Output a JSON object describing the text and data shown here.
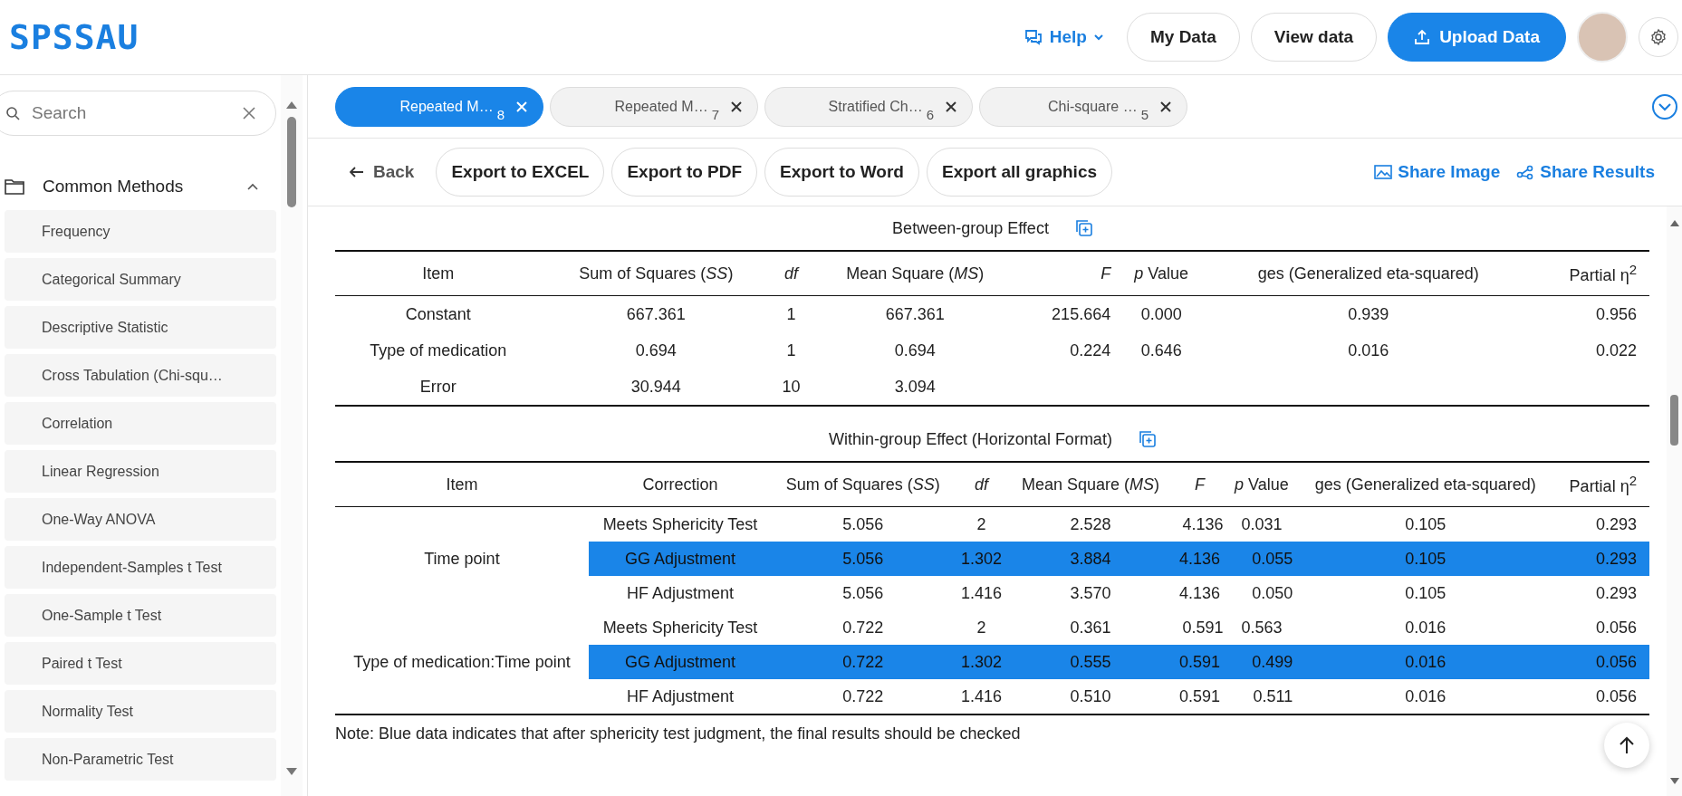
{
  "header": {
    "logo": "SPSSAU",
    "help": "Help",
    "buttons": [
      {
        "label": "My Data",
        "kind": "plain"
      },
      {
        "label": "View data",
        "kind": "plain"
      },
      {
        "label": "Upload Data",
        "kind": "primary"
      }
    ]
  },
  "sidebar": {
    "search": {
      "placeholder": "Search"
    },
    "group": {
      "label": "Common Methods",
      "expanded": true
    },
    "items": [
      "Frequency",
      "Categorical Summary",
      "Descriptive Statistic",
      "Cross Tabulation (Chi-squ…",
      "Correlation",
      "Linear Regression",
      "One-Way ANOVA",
      "Independent-Samples t Test",
      "One-Sample t Test",
      "Paired t Test",
      "Normality Test",
      "Non-Parametric Test"
    ]
  },
  "tabs": [
    {
      "label": "Repeated M…",
      "count": "8",
      "selected": true
    },
    {
      "label": "Repeated M…",
      "count": "7",
      "selected": false
    },
    {
      "label": "Stratified Ch…",
      "count": "6",
      "selected": false
    },
    {
      "label": "Chi-square …",
      "count": "5",
      "selected": false
    }
  ],
  "toolbar": {
    "back": "Back",
    "exports": [
      "Export to EXCEL",
      "Export to PDF",
      "Export to Word",
      "Export all graphics"
    ],
    "share_image": "Share Image",
    "share_results": "Share Results"
  },
  "between_table": {
    "title": "Between-group Effect",
    "columns": [
      {
        "label": "Item",
        "italic": false
      },
      {
        "label": "Sum of Squares (*SS*)",
        "italic": false
      },
      {
        "label": "df",
        "italic": true
      },
      {
        "label": "Mean Square (*MS*)",
        "italic": false
      },
      {
        "label": "F",
        "italic": true
      },
      {
        "label": "*p* Value",
        "italic": false
      },
      {
        "label": "ges (Generalized eta-squared)",
        "italic": false
      },
      {
        "label": "Partial η$^{2}$",
        "italic": false
      }
    ],
    "rows": [
      [
        "Constant",
        "667.361",
        "1",
        "667.361",
        "215.664",
        "0.000",
        "0.939",
        "0.956"
      ],
      [
        "Type of medication",
        "0.694",
        "1",
        "0.694",
        "0.224",
        "0.646",
        "0.016",
        "0.022"
      ],
      [
        "Error",
        "30.944",
        "10",
        "3.094",
        "",
        "",
        "",
        ""
      ]
    ]
  },
  "within_table": {
    "title": "Within-group Effect (Horizontal Format)",
    "columns": [
      {
        "label": "Item",
        "italic": false
      },
      {
        "label": "Correction",
        "italic": false
      },
      {
        "label": "Sum of Squares (*SS*)",
        "italic": false
      },
      {
        "label": "df",
        "italic": true
      },
      {
        "label": "Mean Square (*MS*)",
        "italic": false
      },
      {
        "label": "F",
        "italic": true
      },
      {
        "label": "*p* Value",
        "italic": false
      },
      {
        "label": "ges (Generalized eta-squared)",
        "italic": false
      },
      {
        "label": "Partial η$^{2}$",
        "italic": false
      }
    ],
    "groups": [
      {
        "item": "Time point",
        "rows": [
          {
            "cells": [
              "Meets Sphericity Test",
              "5.056",
              "2",
              "2.528",
              "4.136",
              "0.031",
              "0.105",
              "0.293"
            ],
            "highlighted": false
          },
          {
            "cells": [
              "GG Adjustment",
              "5.056",
              "1.302",
              "3.884",
              "4.136",
              "0.055",
              "0.105",
              "0.293"
            ],
            "highlighted": true
          },
          {
            "cells": [
              "HF Adjustment",
              "5.056",
              "1.416",
              "3.570",
              "4.136",
              "0.050",
              "0.105",
              "0.293"
            ],
            "highlighted": false
          }
        ]
      },
      {
        "item": "Type of medication:Time point",
        "rows": [
          {
            "cells": [
              "Meets Sphericity Test",
              "0.722",
              "2",
              "0.361",
              "0.591",
              "0.563",
              "0.016",
              "0.056"
            ],
            "highlighted": false
          },
          {
            "cells": [
              "GG Adjustment",
              "0.722",
              "1.302",
              "0.555",
              "0.591",
              "0.499",
              "0.016",
              "0.056"
            ],
            "highlighted": true
          },
          {
            "cells": [
              "HF Adjustment",
              "0.722",
              "1.416",
              "0.510",
              "0.591",
              "0.511",
              "0.016",
              "0.056"
            ],
            "highlighted": false
          }
        ]
      }
    ]
  },
  "note": "Note: Blue data indicates that after sphericity test judgment, the final results should be checked"
}
